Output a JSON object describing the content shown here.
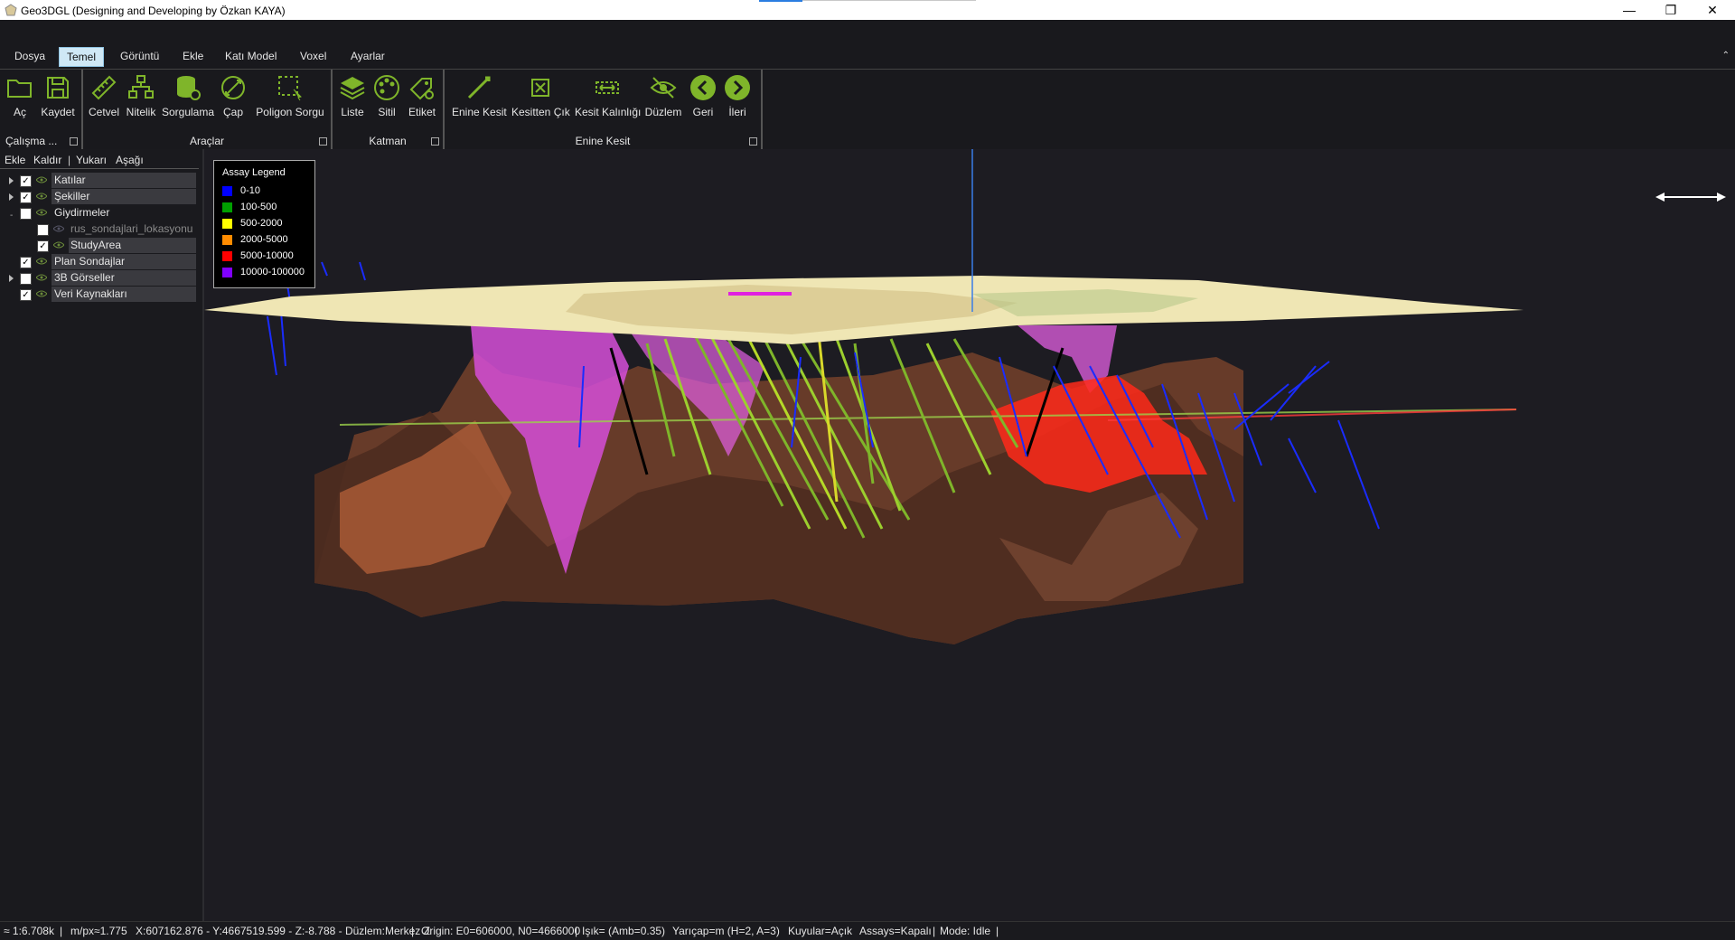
{
  "window": {
    "title": "Geo3DGL (Designing and Developing by Özkan KAYA)",
    "minimize": "—",
    "restore": "❐",
    "close": "✕"
  },
  "menu": {
    "tabs": [
      "Dosya",
      "Temel",
      "Görüntü",
      "Ekle",
      "Katı Model",
      "Voxel",
      "Ayarlar"
    ],
    "active_tab": "Temel",
    "collapse": "⌃"
  },
  "ribbon": {
    "groups": [
      {
        "label": "Çalışma ...",
        "buttons": [
          "Aç",
          "Kaydet"
        ]
      },
      {
        "label": "Araçlar",
        "buttons": [
          "Cetvel",
          "Nitelik",
          "Sorgulama",
          "Çap",
          "Poligon Sorgu"
        ]
      },
      {
        "label": "Katman",
        "buttons": [
          "Liste",
          "Sitil",
          "Etiket"
        ]
      },
      {
        "label": "Enine Kesit",
        "buttons": [
          "Enine Kesit",
          "Kesitten Çık",
          "Kesit Kalınlığı",
          "Düzlem",
          "Geri",
          "İleri"
        ]
      }
    ]
  },
  "layers_panel": {
    "toolbar": [
      "Ekle",
      "Kaldır",
      "Yukarı",
      "Aşağı"
    ],
    "items": [
      {
        "label": "Katılar",
        "checked": true,
        "expandable": true
      },
      {
        "label": "Şekiller",
        "checked": true,
        "expandable": true
      },
      {
        "label": "Giydirmeler",
        "checked": false,
        "expandable": false
      },
      {
        "label": "rus_sondajlari_lokasyonu",
        "checked": false,
        "expandable": false
      },
      {
        "label": "StudyArea",
        "checked": true,
        "expandable": false
      },
      {
        "label": "Plan Sondajlar",
        "checked": true,
        "expandable": false
      },
      {
        "label": "3B Görseller",
        "checked": false,
        "expandable": true
      },
      {
        "label": "Veri Kaynakları",
        "checked": true,
        "expandable": false
      }
    ]
  },
  "legend": {
    "title": "Assay Legend",
    "items": [
      {
        "label": "0-10",
        "color": "#0000ff"
      },
      {
        "label": "100-500",
        "color": "#00a000"
      },
      {
        "label": "500-2000",
        "color": "#ffff00"
      },
      {
        "label": "2000-5000",
        "color": "#ff8c00"
      },
      {
        "label": "5000-10000",
        "color": "#ff0000"
      },
      {
        "label": "10000-100000",
        "color": "#8000ff"
      }
    ]
  },
  "status": {
    "scale": "≈ 1:6.708k",
    "mpx": "m/px≈1.775",
    "coords": "X:607162.876 - Y:4667519.599 - Z:-8.788 - Düzlem:Merkez Z",
    "origin": "Origin: E0=606000, N0=4666000",
    "light": "Işık= (Amb=0.35)",
    "radius": "Yarıçap=m (H=2, A=3)",
    "wells": "Kuyular=Açık",
    "assays": "Assays=Kapalı",
    "mode": "Mode: Idle"
  },
  "colors": {
    "accent_green": "#7fb52a",
    "background": "#1d1c22",
    "terrain": "#efe6b4",
    "solid_brown": "#7a4a33",
    "magenta_body": "#d64fd8",
    "red_body": "#ff2a1a"
  }
}
